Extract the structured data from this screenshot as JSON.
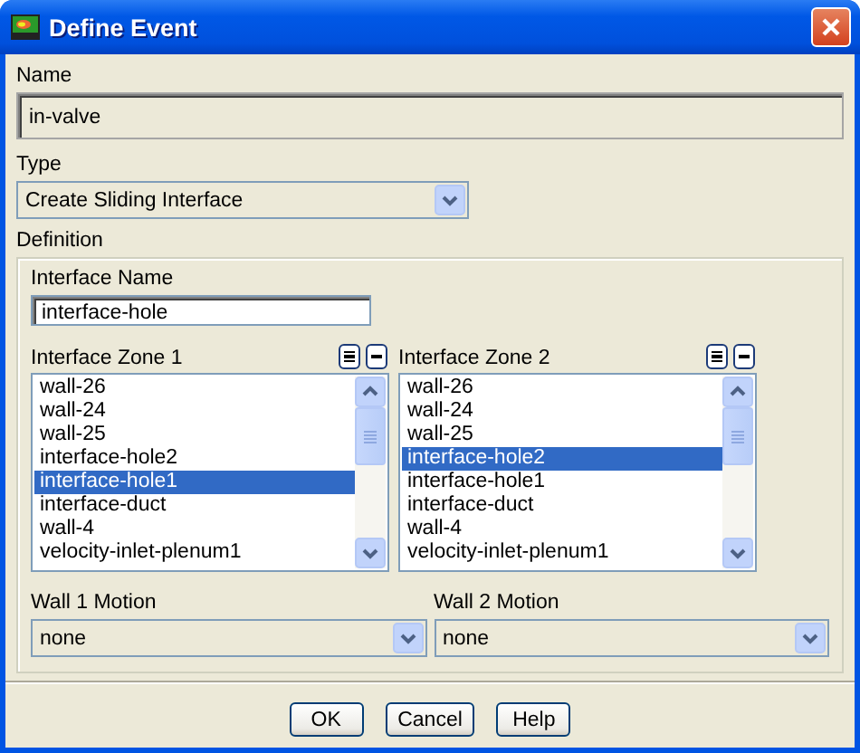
{
  "window": {
    "title": "Define Event"
  },
  "name": {
    "label": "Name",
    "value": "in-valve"
  },
  "type": {
    "label": "Type",
    "value": "Create Sliding Interface"
  },
  "definition": {
    "label": "Definition",
    "interface_name": {
      "label": "Interface Name",
      "value": "interface-hole"
    },
    "zones": [
      {
        "label": "Interface Zone 1",
        "items": [
          {
            "text": "wall-26",
            "selected": false
          },
          {
            "text": "wall-24",
            "selected": false
          },
          {
            "text": "wall-25",
            "selected": false
          },
          {
            "text": "interface-hole2",
            "selected": false
          },
          {
            "text": "interface-hole1",
            "selected": true
          },
          {
            "text": "interface-duct",
            "selected": false
          },
          {
            "text": "wall-4",
            "selected": false
          },
          {
            "text": "velocity-inlet-plenum1",
            "selected": false
          }
        ]
      },
      {
        "label": "Interface Zone 2",
        "items": [
          {
            "text": "wall-26",
            "selected": false
          },
          {
            "text": "wall-24",
            "selected": false
          },
          {
            "text": "wall-25",
            "selected": false
          },
          {
            "text": "interface-hole2",
            "selected": true
          },
          {
            "text": "interface-hole1",
            "selected": false
          },
          {
            "text": "interface-duct",
            "selected": false
          },
          {
            "text": "wall-4",
            "selected": false
          },
          {
            "text": "velocity-inlet-plenum1",
            "selected": false
          }
        ]
      }
    ],
    "motions": [
      {
        "label": "Wall 1 Motion",
        "value": "none"
      },
      {
        "label": "Wall 2 Motion",
        "value": "none"
      }
    ]
  },
  "buttons": [
    "OK",
    "Cancel",
    "Help"
  ]
}
